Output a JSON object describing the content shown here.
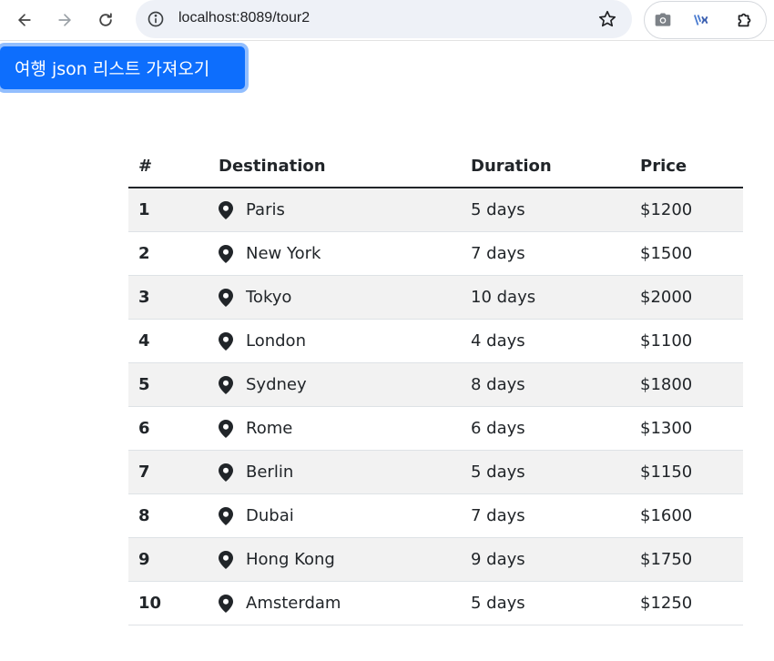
{
  "browser": {
    "url": "localhost:8089/tour2"
  },
  "page": {
    "fetch_button_label": "여행 json 리스트 가져오기"
  },
  "table": {
    "headers": {
      "num": "#",
      "destination": "Destination",
      "duration": "Duration",
      "price": "Price"
    },
    "rows": [
      {
        "num": "1",
        "destination": "Paris",
        "duration": "5 days",
        "price": "$1200"
      },
      {
        "num": "2",
        "destination": "New York",
        "duration": "7 days",
        "price": "$1500"
      },
      {
        "num": "3",
        "destination": "Tokyo",
        "duration": "10 days",
        "price": "$2000"
      },
      {
        "num": "4",
        "destination": "London",
        "duration": "4 days",
        "price": "$1100"
      },
      {
        "num": "5",
        "destination": "Sydney",
        "duration": "8 days",
        "price": "$1800"
      },
      {
        "num": "6",
        "destination": "Rome",
        "duration": "6 days",
        "price": "$1300"
      },
      {
        "num": "7",
        "destination": "Berlin",
        "duration": "5 days",
        "price": "$1150"
      },
      {
        "num": "8",
        "destination": "Dubai",
        "duration": "7 days",
        "price": "$1600"
      },
      {
        "num": "9",
        "destination": "Hong Kong",
        "duration": "9 days",
        "price": "$1750"
      },
      {
        "num": "10",
        "destination": "Amsterdam",
        "duration": "5 days",
        "price": "$1250"
      }
    ]
  },
  "colors": {
    "primary": "#0d6efd",
    "striped_row": "#f2f2f2",
    "text": "#212529"
  },
  "icons": {
    "destination_icon": "map-pin-icon"
  }
}
